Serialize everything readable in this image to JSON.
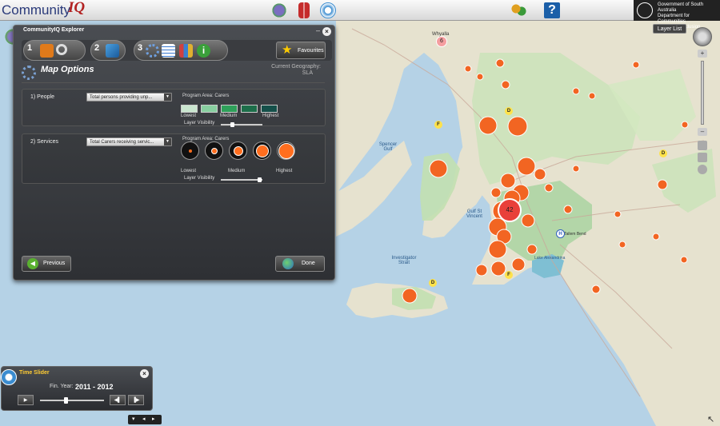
{
  "app": {
    "name": "Community",
    "name_accent": "IQ",
    "gov_line1": "Government of South Australia",
    "gov_line2": "Department for Communities",
    "gov_line3": "and Social Inclusion"
  },
  "explorer": {
    "title": "CommunityIQ Explorer",
    "steps": [
      "1",
      "2",
      "3"
    ],
    "favourites_label": "Favourites",
    "section_title": "Map Options",
    "current_geo_label": "Current Geography:",
    "current_geo_value": "SLA",
    "people": {
      "label": "1) People",
      "select_value": "Total persons providing unp...",
      "program_area": "Program Area:  Carers",
      "swatches": [
        "#c9e6cf",
        "#88cfa0",
        "#2ea05a",
        "#1d6e4a",
        "#15504a"
      ],
      "lowest": "Lowest",
      "medium": "Medium",
      "highest": "Highest",
      "layer_visibility": "Layer Visibility"
    },
    "services": {
      "label": "2) Services",
      "select_value": "Total Carers receiving servic...",
      "program_area": "Program Area:  Carers",
      "lowest": "Lowest",
      "medium": "Medium",
      "highest": "Highest",
      "layer_visibility": "Layer Visibility"
    },
    "previous_label": "Previous",
    "done_label": "Done"
  },
  "time_slider": {
    "title": "Time Slider",
    "fin_year_label": "Fin. Year:",
    "fin_year_value": "2011 - 2012",
    "slider_level": 0.4
  },
  "layer_list_label": "Layer List",
  "map": {
    "labels": [
      "Whyalla",
      "Spencer Gulf",
      "Gulf St Vincent",
      "Investigator Strait",
      "Lake Alexandrina",
      "Tailem Bend"
    ],
    "cluster_counts": [
      "6",
      "42"
    ],
    "markers": [
      "D",
      "F",
      "D",
      "H",
      "F",
      "D",
      "D"
    ]
  }
}
